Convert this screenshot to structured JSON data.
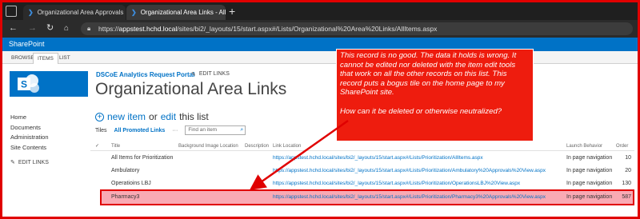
{
  "browser": {
    "tabs": [
      {
        "label": "Organizational Area Approvals L..."
      },
      {
        "label": "Organizational Area Links - All I..."
      }
    ],
    "url_prefix": "https://",
    "url_host": "appstest.hchd.local",
    "url_path": "/sites/bi2/_layouts/15/start.aspx#/Lists/Organizational%20Area%20Links/AllItems.aspx"
  },
  "sharepoint": {
    "brand": "SharePoint"
  },
  "ribbon": {
    "tabs": [
      "BROWSE",
      "ITEMS",
      "LIST"
    ]
  },
  "site": {
    "portal": "DSCoE Analytics Request Portal",
    "edit_links": "EDIT LINKS",
    "title": "Organizational Area Links"
  },
  "leftnav": {
    "items": [
      "Home",
      "Documents",
      "Administration",
      "Site Contents"
    ],
    "edit_links": "EDIT LINKS"
  },
  "actions": {
    "new_item": "new item",
    "or_edit": "or",
    "edit": "edit",
    "this_list": "this list"
  },
  "views": {
    "tiles": "Tiles",
    "all_promoted": "All Promoted Links",
    "more": "···",
    "search_placeholder": "Find an item"
  },
  "table": {
    "columns": [
      "Title",
      "Background Image Location",
      "Description",
      "Link Location",
      "Launch Behavior",
      "Order"
    ],
    "rows": [
      {
        "title": "All Items for Prioritization",
        "link": "https://appstest.hchd.local/sites/bi2/_layouts/15/start.aspx#/Lists/Prioritization/AllItems.aspx",
        "launch": "In page navigation",
        "order": "10"
      },
      {
        "title": "Ambulatory",
        "link": "https://appstest.hchd.local/sites/bi2/_layouts/15/start.aspx#/Lists/Prioritization/Ambulatory%20Approvals%20View.aspx",
        "launch": "In page navigation",
        "order": "20"
      },
      {
        "title": "Operatioins LBJ",
        "link": "https://appstest.hchd.local/sites/bi2/_layouts/15/start.aspx#/Lists/Prioritization/OperationsLBJ%20View.aspx",
        "launch": "In page navigation",
        "order": "130"
      },
      {
        "title": "Pharmacy3",
        "link": "https://appstest.hchd.local/sites/bi2/_layouts/15/start.aspx#/Lists/Prioritization/Pharmacy3%20Approvals%20View.aspx",
        "launch": "In page navigation",
        "order": "587"
      }
    ]
  },
  "callout": {
    "para1": "This record is no good.  The data it holds is wrong.  It cannot be edited nor deleted with the item edit tools that work on all the other records on this list.  This record puts a bogus tile on the home page to my SharePoint site.",
    "para2": "How can it be deleted or otherwise neutralized?"
  },
  "colors": {
    "sharepoint_blue": "#0072c6",
    "callout_red": "#ee1c0e",
    "highlight_row": "#f9aab4"
  }
}
